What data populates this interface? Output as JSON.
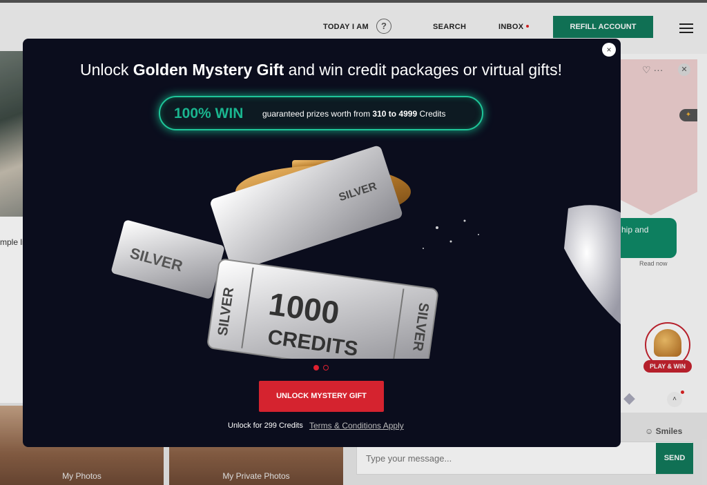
{
  "nav": {
    "today": "TODAY I AM",
    "help": "?",
    "search": "SEARCH",
    "inbox": "INBOX",
    "refill": "REFILL ACCOUNT"
  },
  "background": {
    "left_snippet": "mple li",
    "photo1": "My Photos",
    "photo2": "My Private Photos",
    "bubble_text": "hip and",
    "read_now": "Read now",
    "play_win": "PLAY & WIN",
    "smiles": "Smiles",
    "chat_placeholder": "Type your message...",
    "send": "SEND"
  },
  "modal": {
    "headline_pre": "Unlock ",
    "headline_bold": "Golden Mystery Gift",
    "headline_post": " and win credit packages or virtual gifts!",
    "win": "100% WIN",
    "pill_pre": "guaranteed prizes worth from ",
    "pill_bold": "310 to 4999",
    "pill_post": " Credits",
    "ticket_silver": "SILVER",
    "ticket_amount": "1000",
    "ticket_unit": "CREDITS",
    "button": "UNLOCK MYSTERY GIFT",
    "note": "Unlock for 299 Credits",
    "terms": "Terms & Conditions Apply",
    "close": "×"
  },
  "colors": {
    "accent_green": "#127a5c",
    "cta_red": "#d5232f",
    "glow": "#1fc69a"
  }
}
